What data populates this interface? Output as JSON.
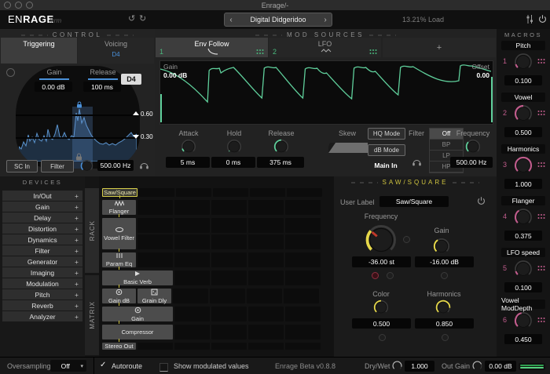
{
  "theme": {
    "blue": "#4a90d9",
    "green": "#5fcf9b",
    "yellow": "#e6d84a",
    "pink": "#c05c8c",
    "hdr_yellow": "#cfc33f"
  },
  "window": {
    "title": "Enrage/-"
  },
  "header": {
    "brand_en": "EN",
    "brand_rage": "RAGE",
    "maker": "lkrm",
    "undo": "↺",
    "redo": "↻",
    "preset_prev": "‹",
    "preset_name": "Digital Didgeridoo",
    "preset_next": "›",
    "load": "13.21% Load"
  },
  "control": {
    "title": "CONTROL",
    "tab_triggering": "Triggering",
    "tab_voicing": "Voicing",
    "voicing_note": "D4",
    "gain_label": "Gain",
    "gain_value": "0.00 dB",
    "release_label": "Release",
    "release_value": "100 ms",
    "note_badge": "D4",
    "threshold_high": "0.60",
    "threshold_low": "0.30",
    "sc_in": "SC In",
    "filter": "Filter",
    "freq_value": "500.00 Hz"
  },
  "mod": {
    "title": "MOD SOURCES",
    "tab1_num": "1",
    "tab1_label": "Env Follow",
    "tab2_num": "2",
    "tab2_label": "LFO",
    "tab3_label": "+",
    "gain_label": "Gain",
    "gain_value": "0.00 dB",
    "offset_label": "Offset",
    "offset_value": "0.00",
    "attack_label": "Attack",
    "attack_value": "5 ms",
    "hold_label": "Hold",
    "hold_value": "0 ms",
    "release_label": "Release",
    "release_value": "375 ms",
    "skew_label": "Skew",
    "hq_mode": "HQ Mode",
    "db_mode": "dB Mode",
    "main_in": "Main In",
    "filter_label": "Filter",
    "modes": [
      "Off",
      "BP",
      "LP",
      "HP"
    ],
    "modes_active": 0,
    "freq_label": "Frequency",
    "freq_value": "500.00 Hz"
  },
  "macros": {
    "title": "MACROS",
    "items": [
      {
        "num": "1",
        "label": "Pitch",
        "value": "0.100"
      },
      {
        "num": "2",
        "label": "Vowel",
        "value": "0.500"
      },
      {
        "num": "3",
        "label": "Harmonics",
        "value": "1.000"
      },
      {
        "num": "4",
        "label": "Flanger",
        "value": "0.375"
      },
      {
        "num": "5",
        "label": "LFO speed",
        "value": "0.100"
      },
      {
        "num": "6",
        "label": "Vowel ModDepth",
        "value": "0.450"
      }
    ]
  },
  "devices": {
    "title": "DEVICES",
    "plus": "+",
    "categories": [
      "In/Out",
      "Gain",
      "Delay",
      "Distortion",
      "Dynamics",
      "Filter",
      "Generator",
      "Imaging",
      "Modulation",
      "Pitch",
      "Reverb",
      "Analyzer"
    ]
  },
  "rack": {
    "rack_label": "RACK",
    "matrix_label": "MATRIX",
    "rows": [
      {
        "label": "Saw/Square",
        "span": 1,
        "h": 13,
        "selected": true,
        "cells": 5
      },
      {
        "label": "Flanger",
        "icon": "zigzag-wave",
        "span": 1,
        "h": 21,
        "cells": 5
      },
      {
        "label": "Vowel Filter",
        "icon": "ellipse",
        "span": 1,
        "h": 42,
        "cells": 5,
        "subrows": 2
      },
      {
        "label": "Param Eq",
        "icon": "eq-bars",
        "span": 1,
        "h": 21,
        "cells": 5
      },
      {
        "label": "Basic Verb",
        "icon": "play",
        "span": 2,
        "h": 21,
        "cells": 4
      },
      {
        "label": "Gain dB",
        "icon": "target",
        "label2": "Grain Dly",
        "icon2": "grain",
        "span": 1,
        "h": 21,
        "cells": 4
      },
      {
        "label": "Gain",
        "icon": "target",
        "span": 2,
        "h": 21,
        "cells": 4
      },
      {
        "label": "Compressor",
        "span": 2,
        "h": 21,
        "cells": 4
      },
      {
        "label": "Stereo Out",
        "span": 1,
        "h": 11,
        "cells": 5
      }
    ]
  },
  "saw_panel": {
    "title": "SAW/SQUARE",
    "user_label": "User Label",
    "name_value": "Saw/Square",
    "freq_label": "Frequency",
    "freq_value": "-36.00 st",
    "gain_label": "Gain",
    "gain_value": "-16.00 dB",
    "color_label": "Color",
    "color_value": "0.500",
    "harm_label": "Harmonics",
    "harm_value": "0.850"
  },
  "footer": {
    "oversampling_label": "Oversampling",
    "oversampling_value": "Off",
    "autoroute_check": "✓",
    "autoroute": "Autoroute",
    "show_modulated": "Show modulated values",
    "version": "Enrage Beta v0.8.8",
    "dry_wet_label": "Dry/Wet",
    "dry_wet_value": "1.000",
    "out_gain_label": "Out Gain",
    "out_gain_value": "0.00 dB"
  }
}
